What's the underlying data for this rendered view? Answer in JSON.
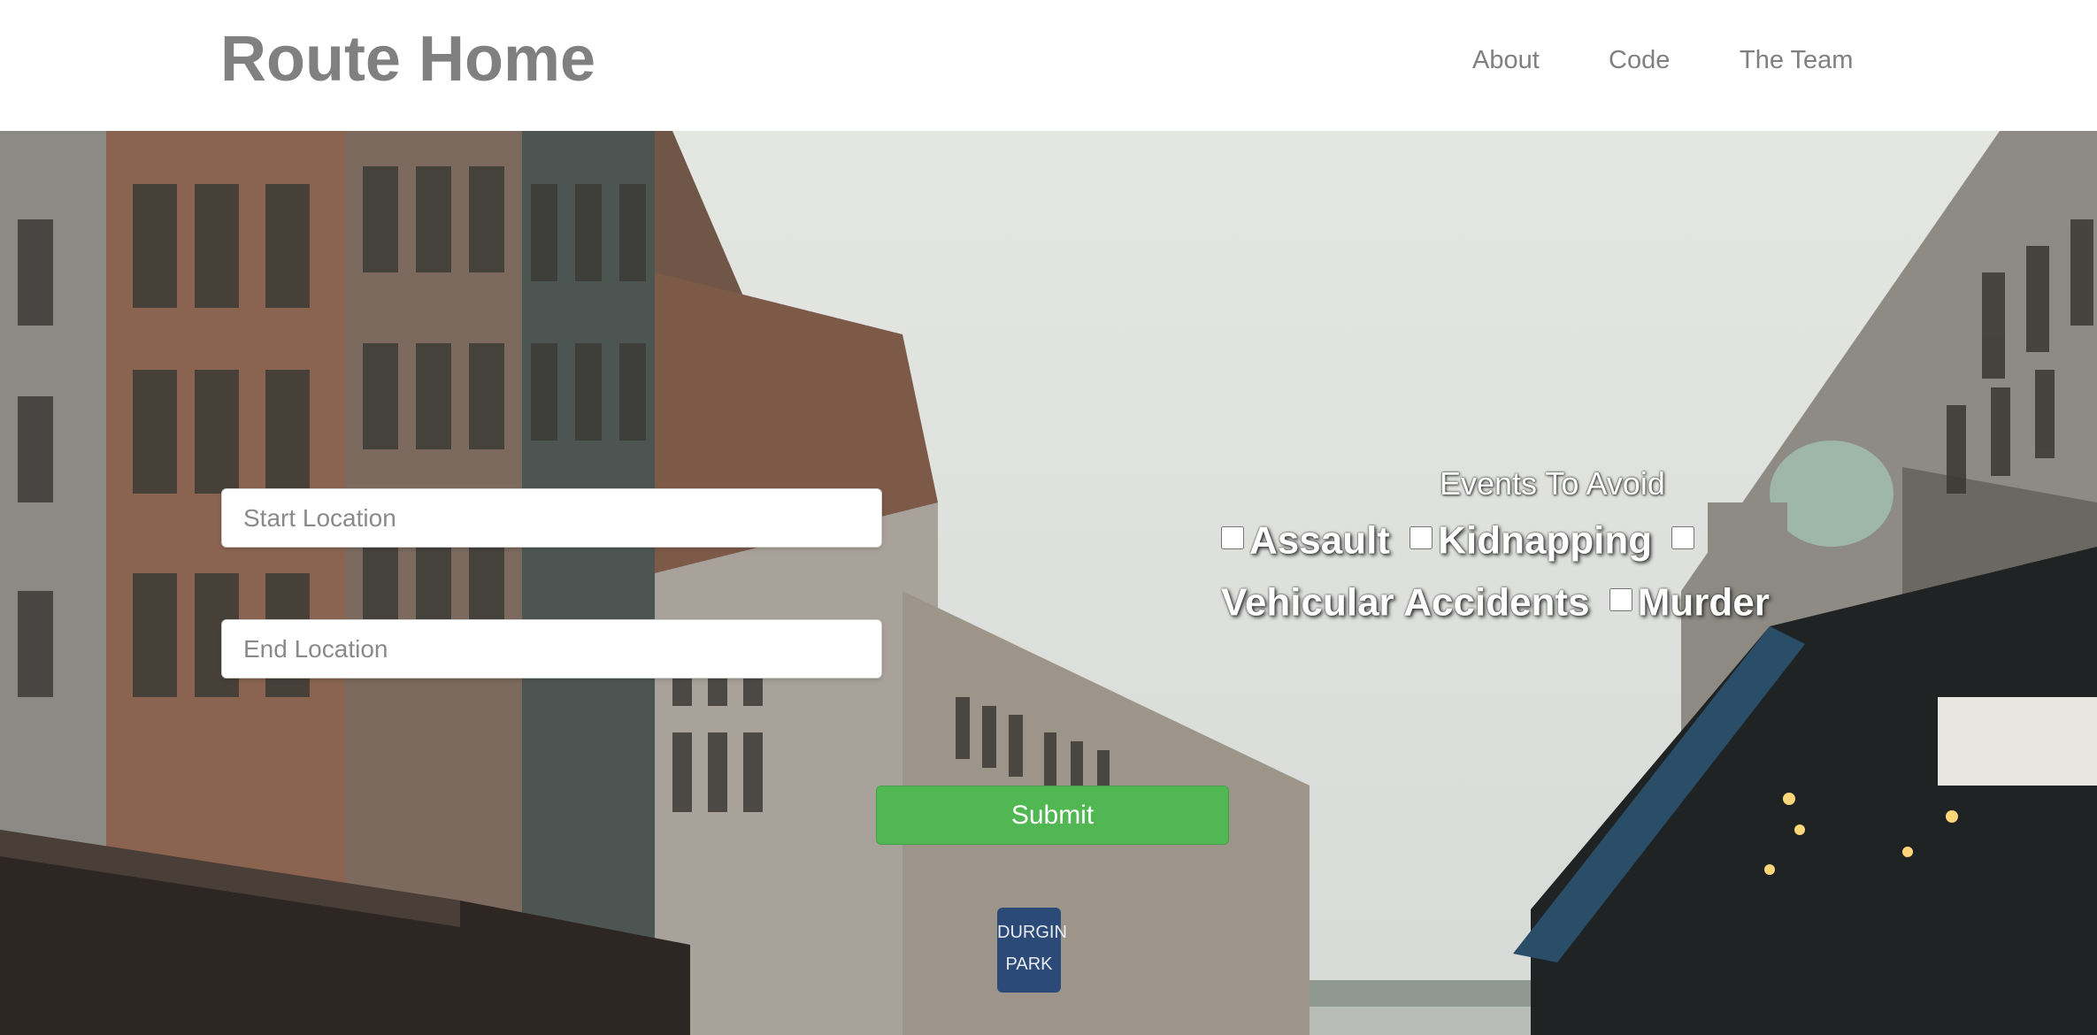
{
  "header": {
    "brand": "Route Home",
    "nav": [
      "About",
      "Code",
      "The Team"
    ]
  },
  "form": {
    "start_placeholder": "Start Location",
    "end_placeholder": "End Location",
    "submit_label": "Submit"
  },
  "events": {
    "title": "Events To Avoid",
    "options": [
      "Assault",
      "Kidnapping",
      "Vehicular Accidents",
      "Murder"
    ]
  },
  "sign_text": [
    "DURGIN",
    "PARK"
  ],
  "colors": {
    "brand_text": "#808080",
    "submit_bg": "#50b753",
    "header_bg": "#ffffff"
  }
}
